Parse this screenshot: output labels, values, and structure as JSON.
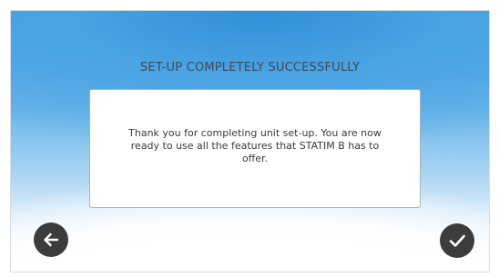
{
  "screen": {
    "title": "SET-UP COMPLETELY SUCCESSFULLY",
    "message": "Thank you for completing unit set-up. You are now ready to use all the features that STATIM B has to offer."
  },
  "navigation": {
    "back_icon": "arrow-left-icon",
    "confirm_icon": "checkmark-icon"
  },
  "colors": {
    "background_top": "#3f9ce0",
    "background_bottom": "#ffffff",
    "button_fill": "#3c3c3c",
    "title_text": "#3f4a56"
  }
}
